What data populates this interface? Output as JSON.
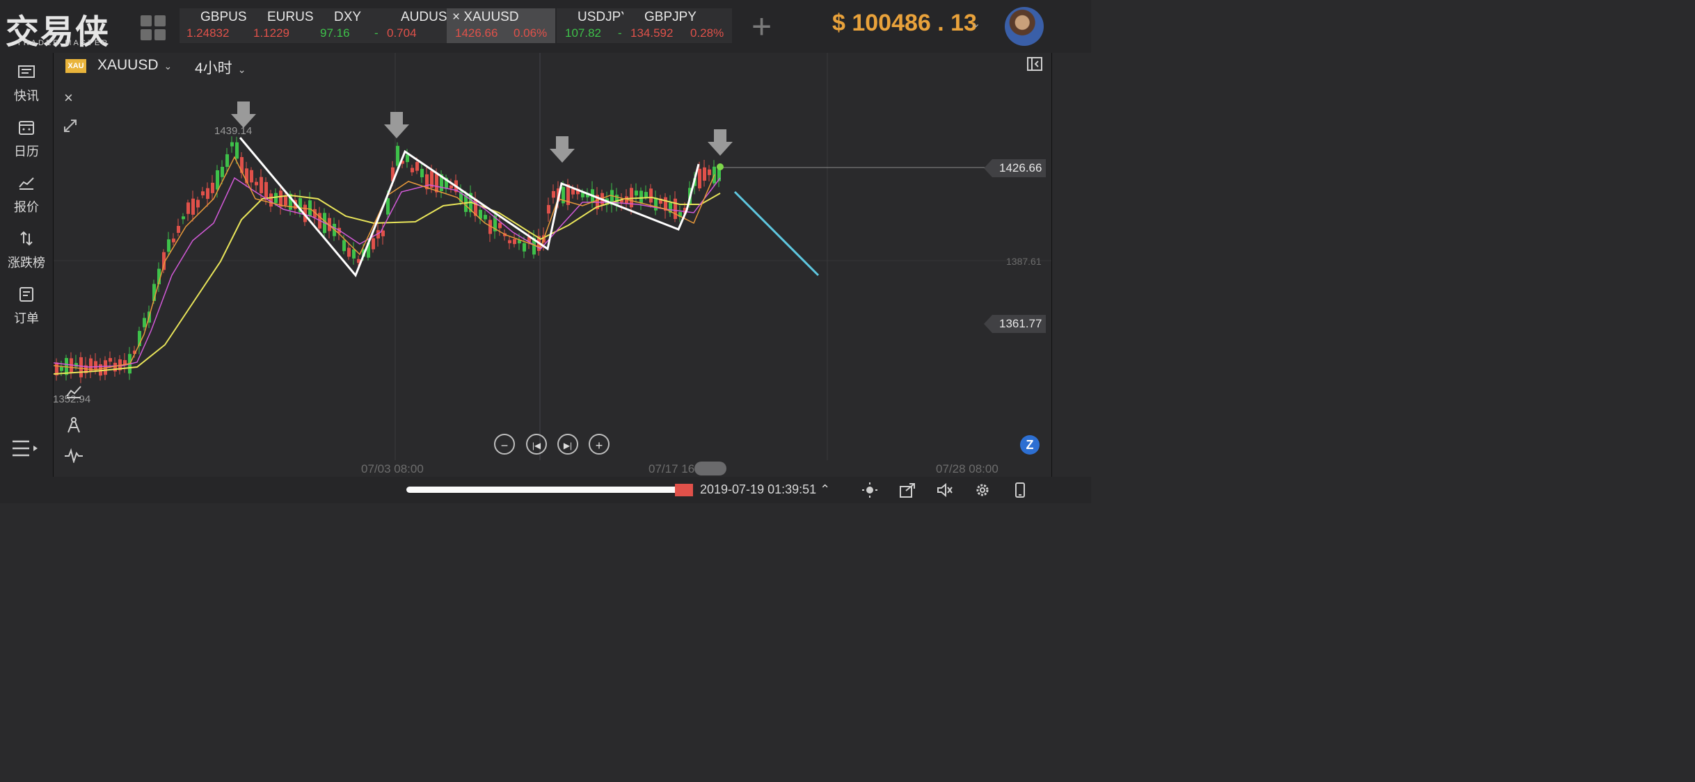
{
  "header": {
    "logo_cn": "交易侠",
    "logo_en": "TRADER MASTER",
    "tickers": [
      {
        "symbol": "GBPUSI",
        "price": "1.24832",
        "change": "",
        "dir": "down"
      },
      {
        "symbol": "EURUSI",
        "price": "1.1229",
        "change": "",
        "dir": "down"
      },
      {
        "symbol": "DXY",
        "price": "97.16",
        "change": "-",
        "dir": "up"
      },
      {
        "symbol": "AUDUS",
        "price": "0.704",
        "change": "",
        "dir": "down"
      },
      {
        "symbol": "× XAUUSD",
        "price": "1426.66",
        "change": "0.06%",
        "dir": "down"
      },
      {
        "symbol": "USDJPY",
        "price": "107.82",
        "change": "-",
        "dir": "up"
      },
      {
        "symbol": "GBPJPY",
        "price": "134.592",
        "change": "0.28%",
        "dir": "down"
      }
    ],
    "balance": "$ 100486 . 13",
    "colors": {
      "up": "#3ec14a",
      "down": "#e0514a",
      "accent": "#e9a23b"
    }
  },
  "sidebar": {
    "items": [
      {
        "label": "快讯",
        "icon": "news-icon"
      },
      {
        "label": "日历",
        "icon": "calendar-icon"
      },
      {
        "label": "报价",
        "icon": "quote-chart-icon"
      },
      {
        "label": "涨跌榜",
        "icon": "sort-arrows-icon"
      },
      {
        "label": "订单",
        "icon": "order-list-icon"
      }
    ]
  },
  "chart": {
    "symbol_badge": "XAU",
    "symbol": "XAUUSD",
    "period": "4小时",
    "price_tags": {
      "last": "1426.66",
      "lower": "1361.77"
    },
    "axis_labels": {
      "high_mark": "1439.14",
      "low_mark": "1352.94",
      "mid": "1387.61"
    },
    "x_labels": [
      "07/03 08:00",
      "07/17 16:00",
      "07/28 08:00"
    ]
  },
  "chart_data": {
    "type": "candlestick",
    "title": "",
    "x": [
      "07/03 08:00",
      "07/17 16:00",
      "07/28 08:00"
    ],
    "y_marks": [
      1352.94,
      1361.77,
      1387.61,
      1426.66,
      1439.14
    ],
    "last_price": 1426.66,
    "series": [
      {
        "name": "",
        "color": "#e9e55a"
      },
      {
        "name": "",
        "color": "#d25ad8"
      },
      {
        "name": "",
        "color": "#e99a3b"
      }
    ],
    "annotations": [
      "zigzag-white-line",
      "projection-cyan-line",
      "down-arrows x4"
    ]
  },
  "status": {
    "datetime": "2019-07-19 01:39:51"
  }
}
